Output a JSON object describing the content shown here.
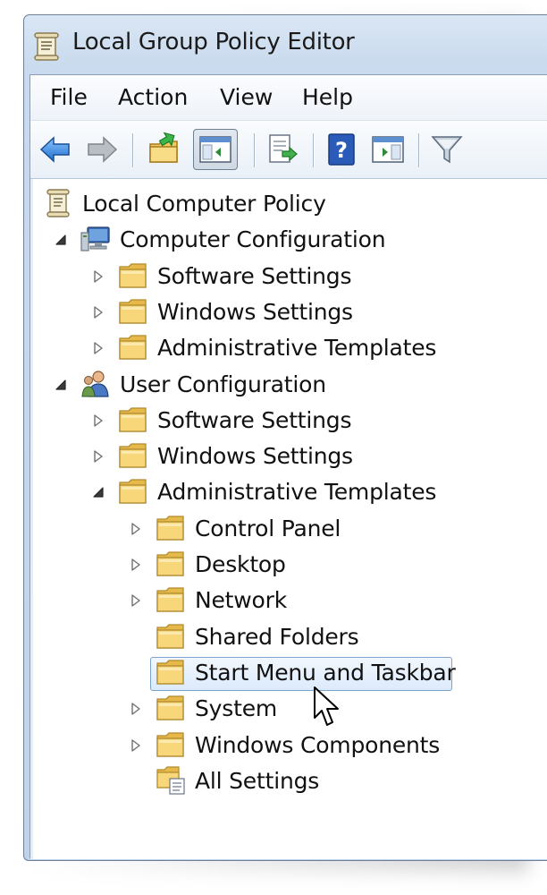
{
  "window": {
    "title": "Local Group Policy Editor"
  },
  "menu": [
    {
      "label": "File"
    },
    {
      "label": "Action"
    },
    {
      "label": "View"
    },
    {
      "label": "Help"
    }
  ],
  "toolbar": {
    "buttons": [
      {
        "icon": "back-arrow-icon"
      },
      {
        "icon": "forward-arrow-icon"
      },
      {
        "icon": "up-folder-icon"
      },
      {
        "icon": "show-hide-console-tree-icon",
        "pressed": true
      },
      {
        "icon": "export-list-icon"
      },
      {
        "icon": "help-icon"
      },
      {
        "icon": "show-hide-action-pane-icon"
      },
      {
        "icon": "filter-icon"
      }
    ]
  },
  "tree": {
    "root": {
      "label": "Local Computer Policy",
      "icon": "policy-scroll-icon"
    },
    "nodes": [
      {
        "label": "Computer Configuration",
        "icon": "computer-icon",
        "level": 1,
        "expander": "expanded"
      },
      {
        "label": "Software Settings",
        "icon": "folder-icon",
        "level": 2,
        "expander": "collapsed"
      },
      {
        "label": "Windows Settings",
        "icon": "folder-icon",
        "level": 2,
        "expander": "collapsed"
      },
      {
        "label": "Administrative Templates",
        "icon": "folder-icon",
        "level": 2,
        "expander": "collapsed"
      },
      {
        "label": "User Configuration",
        "icon": "users-icon",
        "level": 1,
        "expander": "expanded"
      },
      {
        "label": "Software Settings",
        "icon": "folder-icon",
        "level": 2,
        "expander": "collapsed"
      },
      {
        "label": "Windows Settings",
        "icon": "folder-icon",
        "level": 2,
        "expander": "collapsed"
      },
      {
        "label": "Administrative Templates",
        "icon": "folder-icon",
        "level": 2,
        "expander": "expanded"
      },
      {
        "label": "Control Panel",
        "icon": "folder-icon",
        "level": 3,
        "expander": "collapsed"
      },
      {
        "label": "Desktop",
        "icon": "folder-icon",
        "level": 3,
        "expander": "collapsed"
      },
      {
        "label": "Network",
        "icon": "folder-icon",
        "level": 3,
        "expander": "collapsed"
      },
      {
        "label": "Shared Folders",
        "icon": "folder-icon",
        "level": 3,
        "expander": "none"
      },
      {
        "label": "Start Menu and Taskbar",
        "icon": "folder-icon",
        "level": 3,
        "expander": "none",
        "selected": true
      },
      {
        "label": "System",
        "icon": "folder-icon",
        "level": 3,
        "expander": "collapsed"
      },
      {
        "label": "Windows Components",
        "icon": "folder-icon",
        "level": 3,
        "expander": "collapsed"
      },
      {
        "label": "All Settings",
        "icon": "all-settings-icon",
        "level": 3,
        "expander": "none"
      }
    ]
  },
  "colors": {
    "selection_border": "#7da2ce",
    "folder_fill": "#f4cf6a",
    "arrow_blue": "#2f7fd9"
  }
}
